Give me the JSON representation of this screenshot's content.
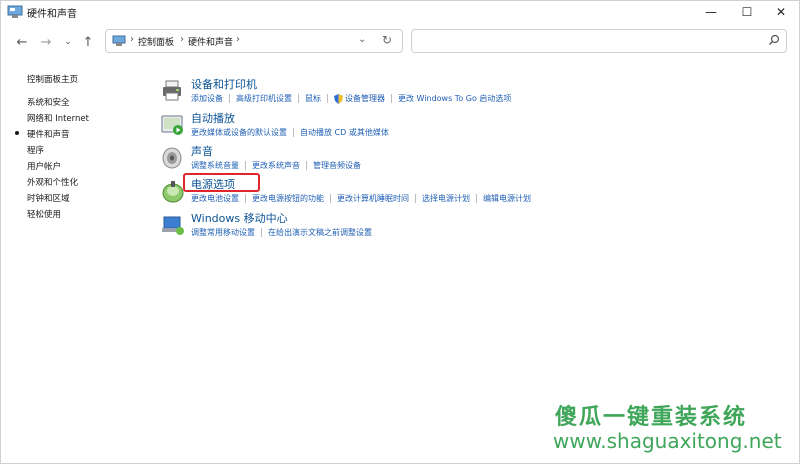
{
  "window": {
    "title": "硬件和声音",
    "controls": {
      "minimize": "—",
      "maximize": "☐",
      "close": "✕"
    }
  },
  "nav": {
    "back": "←",
    "forward": "→",
    "recent": "⌄",
    "up": "↑",
    "breadcrumb": [
      "控制面板",
      "硬件和声音"
    ],
    "breadcrumb_sep": "›",
    "dropdown": "⌄",
    "refresh": "↻"
  },
  "search": {
    "placeholder": ""
  },
  "sidebar": {
    "items": [
      {
        "label": "控制面板主页",
        "active": false
      },
      {
        "label": "系统和安全",
        "active": false
      },
      {
        "label": "网络和 Internet",
        "active": false
      },
      {
        "label": "硬件和声音",
        "active": true
      },
      {
        "label": "程序",
        "active": false
      },
      {
        "label": "用户帐户",
        "active": false
      },
      {
        "label": "外观和个性化",
        "active": false
      },
      {
        "label": "时钟和区域",
        "active": false
      },
      {
        "label": "轻松使用",
        "active": false
      }
    ]
  },
  "categories": [
    {
      "title": "设备和打印机",
      "icon": "printer-icon",
      "links": [
        "添加设备",
        "高级打印机设置",
        "鼠标",
        "设备管理器",
        "更改 Windows To Go 启动选项"
      ]
    },
    {
      "title": "自动播放",
      "icon": "autoplay-icon",
      "links": [
        "更改媒体或设备的默认设置",
        "自动播放 CD 或其他媒体"
      ]
    },
    {
      "title": "声音",
      "icon": "speaker-icon",
      "links": [
        "调整系统音量",
        "更改系统声音",
        "管理音频设备"
      ]
    },
    {
      "title": "电源选项",
      "icon": "power-icon",
      "links": [
        "更改电池设置",
        "更改电源按钮的功能",
        "更改计算机睡眠时间",
        "选择电源计划",
        "编辑电源计划"
      ]
    },
    {
      "title": "Windows 移动中心",
      "icon": "mobility-center-icon",
      "links": [
        "调整常用移动设置",
        "在给出演示文稿之前调整设置"
      ]
    }
  ],
  "watermark": {
    "brand": "傻瓜一键重装系统",
    "url": "www.shaguaxitong.net"
  },
  "colors": {
    "link": "#1f5fb5",
    "title": "#0b5394",
    "highlight": "#e0262b",
    "watermark": "#3fa65a"
  }
}
